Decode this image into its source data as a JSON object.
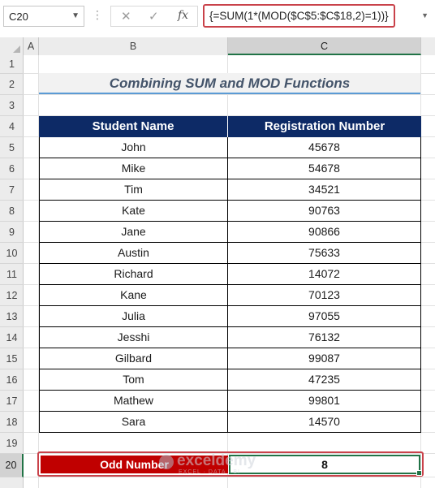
{
  "formula_bar": {
    "name_box": "C20",
    "fx_label": "fx",
    "formula": "{=SUM(1*(MOD($C$5:$C$18,2)=1))}"
  },
  "columns": [
    "A",
    "B",
    "C"
  ],
  "rows": [
    "1",
    "2",
    "3",
    "4",
    "5",
    "6",
    "7",
    "8",
    "9",
    "10",
    "11",
    "12",
    "13",
    "14",
    "15",
    "16",
    "17",
    "18",
    "19",
    "20"
  ],
  "title": "Combining SUM and MOD Functions",
  "table": {
    "headers": [
      "Student Name",
      "Registration Number"
    ],
    "rows": [
      [
        "John",
        "45678"
      ],
      [
        "Mike",
        "54678"
      ],
      [
        "Tim",
        "34521"
      ],
      [
        "Kate",
        "90763"
      ],
      [
        "Jane",
        "90866"
      ],
      [
        "Austin",
        "75633"
      ],
      [
        "Richard",
        "14072"
      ],
      [
        "Kane",
        "70123"
      ],
      [
        "Julia",
        "97055"
      ],
      [
        "Jesshi",
        "76132"
      ],
      [
        "Gilbard",
        "99087"
      ],
      [
        "Tom",
        "47235"
      ],
      [
        "Mathew",
        "99801"
      ],
      [
        "Sara",
        "14570"
      ]
    ]
  },
  "result": {
    "label": "Odd Number",
    "value": "8"
  },
  "watermark": {
    "name": "exceldemy",
    "tagline": "EXCEL · DATA · BI"
  },
  "colors": {
    "header_bg": "#0d2a66",
    "result_label_bg": "#c00000",
    "highlight_border": "#c9424a",
    "selection": "#217346",
    "title_text": "#44546a",
    "title_underline": "#5b9bd5"
  }
}
